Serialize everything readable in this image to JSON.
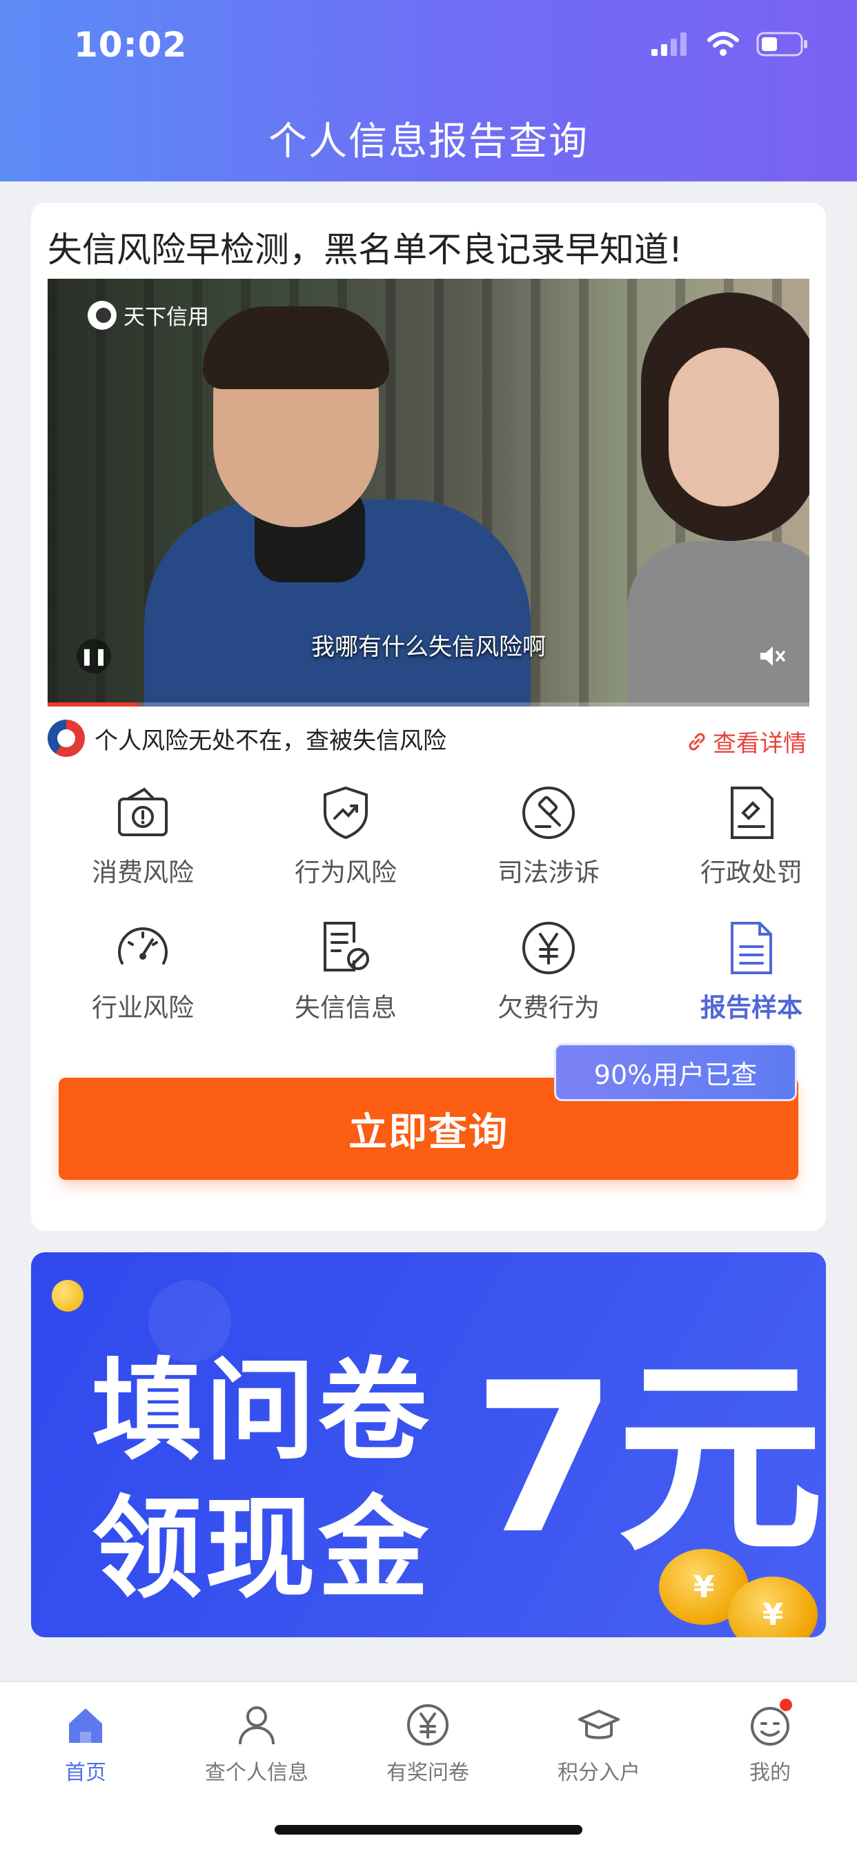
{
  "status_bar": {
    "time": "10:02"
  },
  "header": {
    "title": "个人信息报告查询"
  },
  "card": {
    "headline": "失信风险早检测，黑名单不良记录早知道!",
    "video": {
      "logo_text": "天下信用",
      "subtitle": "我哪有什么失信风险啊",
      "progress": 0.12
    },
    "info": {
      "text": "个人风险无处不在，查被失信风险",
      "link": "查看详情"
    },
    "grid": [
      {
        "label": "消费风险",
        "icon": "wallet-alert-icon"
      },
      {
        "label": "行为风险",
        "icon": "shield-trend-icon"
      },
      {
        "label": "司法涉诉",
        "icon": "gavel-icon"
      },
      {
        "label": "行政处罚",
        "icon": "document-stamp-icon"
      },
      {
        "label": "行业风险",
        "icon": "speedometer-icon"
      },
      {
        "label": "失信信息",
        "icon": "document-ban-icon"
      },
      {
        "label": "欠费行为",
        "icon": "yuan-circle-icon"
      },
      {
        "label": "报告样本",
        "icon": "report-document-icon",
        "highlight": true
      }
    ],
    "cta": {
      "label": "立即查询",
      "badge": "90%用户已查"
    }
  },
  "banner": {
    "line1": "填问卷",
    "line2": "领现金",
    "amount": "7元",
    "coin_symbol": "¥"
  },
  "tabbar": [
    {
      "label": "首页",
      "icon": "home-icon",
      "active": true
    },
    {
      "label": "查个人信息",
      "icon": "person-icon"
    },
    {
      "label": "有奖问卷",
      "icon": "yuan-circle-icon"
    },
    {
      "label": "积分入户",
      "icon": "graduation-cap-icon"
    },
    {
      "label": "我的",
      "icon": "smiley-icon",
      "badge": true
    }
  ],
  "colors": {
    "header_gradient": [
      "#5b8cf6",
      "#7b62f3"
    ],
    "cta": "#fb5d12",
    "accent": "#4f67d8",
    "banner": "#3a54f0",
    "link_red": "#e8443d"
  }
}
